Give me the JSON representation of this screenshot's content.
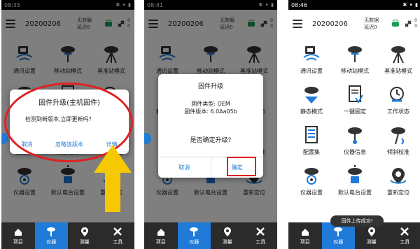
{
  "panels": [
    {
      "time": "08:35",
      "project": "20200206",
      "rtk_status": "无效解",
      "delay": "延迟0",
      "sat_count": "0",
      "sat_count2": "0",
      "dialog": {
        "title": "固件升级(主机固件)",
        "message": "检测到新版本,立即更新吗?",
        "cancel": "取消",
        "ignore": "忽略该版本",
        "details": "详情"
      }
    },
    {
      "time": "08:41",
      "project": "20200206",
      "rtk_status": "无效解",
      "delay": "延迟0",
      "sat_count": "0",
      "sat_count2": "0",
      "dialog": {
        "title": "固件升级",
        "type_line": "固件类型: OEM",
        "version_line": "固件版本: 6.0Aa05b",
        "question": "是否确定升级?",
        "cancel": "取消",
        "ok": "确定"
      }
    },
    {
      "time": "08:46",
      "project": "20200206",
      "rtk_status": "无数据",
      "delay": "延迟0",
      "sat_count": "0",
      "sat_count2": "0",
      "toast": "固件上传成功!"
    }
  ],
  "grid": [
    {
      "label": "通讯设置",
      "icon": "comm-settings-icon"
    },
    {
      "label": "移动站模式",
      "icon": "rover-mode-icon"
    },
    {
      "label": "基准站模式",
      "icon": "base-mode-icon"
    },
    {
      "label": "静态模式",
      "icon": "static-mode-icon"
    },
    {
      "label": "一键固定",
      "icon": "one-key-fix-icon"
    },
    {
      "label": "工作状态",
      "icon": "work-status-icon"
    },
    {
      "label": "配置集",
      "icon": "config-set-icon"
    },
    {
      "label": "仪器信息",
      "icon": "device-info-icon"
    },
    {
      "label": "倾斜校准",
      "icon": "tilt-calibration-icon"
    },
    {
      "label": "仪器设置",
      "icon": "device-settings-icon"
    },
    {
      "label": "默认电台设置",
      "icon": "radio-settings-icon"
    },
    {
      "label": "重新定位",
      "icon": "relocate-icon"
    }
  ],
  "tabs": [
    {
      "label": "项目",
      "icon": "home-icon"
    },
    {
      "label": "仪器",
      "icon": "instrument-icon"
    },
    {
      "label": "测量",
      "icon": "measure-icon"
    },
    {
      "label": "工具",
      "icon": "tools-icon"
    }
  ],
  "colors": {
    "accent": "#1f7ad8",
    "highlight": "#e02020",
    "arrow": "#f5c800",
    "bar": "#2b2b2b"
  }
}
